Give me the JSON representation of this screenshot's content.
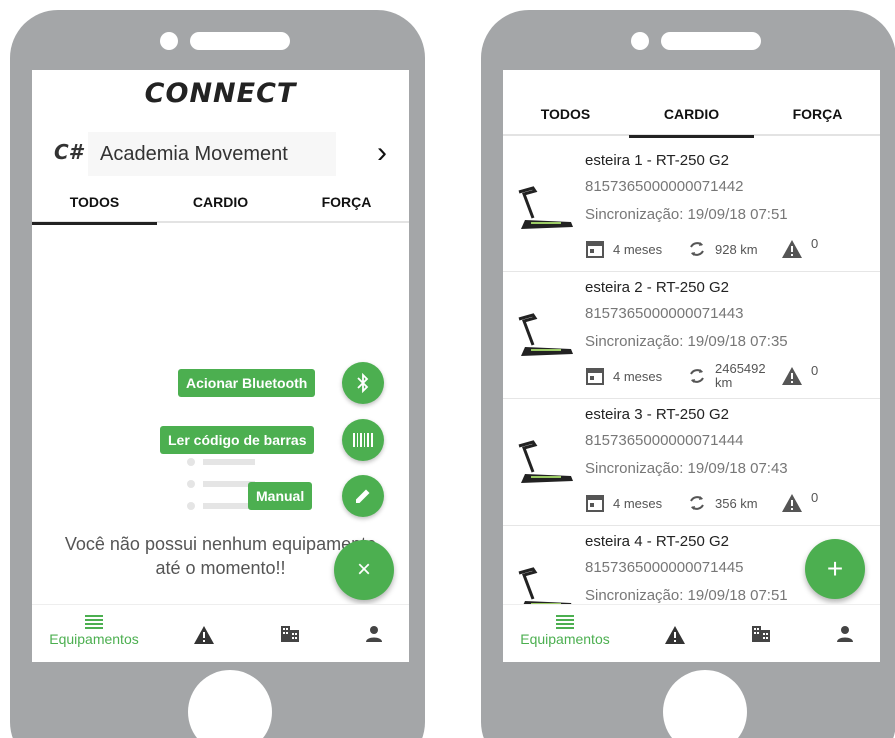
{
  "left_screen": {
    "logo": "CONNECT",
    "academy": {
      "mark": "C#",
      "name": "Academia Movement",
      "next": "›"
    },
    "tabs": [
      "TODOS",
      "CARDIO",
      "FORÇA"
    ],
    "active_tab": "TODOS",
    "actions": [
      {
        "label": "Acionar Bluetooth",
        "icon": "bluetooth-icon"
      },
      {
        "label": "Ler código de barras",
        "icon": "barcode-icon"
      },
      {
        "label": "Manual",
        "icon": "pencil-icon"
      }
    ],
    "close_fab": "×",
    "empty_message_line1": "Você não possui nenhum equipamento",
    "empty_message_line2": "até o momento!!",
    "nav": {
      "equipment_label": "Equipamentos"
    }
  },
  "right_screen": {
    "tabs": [
      "TODOS",
      "CARDIO",
      "FORÇA"
    ],
    "active_tab": "CARDIO",
    "items": [
      {
        "name": "esteira 1 - RT-250 G2",
        "serial": "8157365000000071442",
        "sync": "Sincronização: 19/09/18 07:51",
        "age": "4 meses",
        "distance": "928 km",
        "alerts": "0"
      },
      {
        "name": "esteira 2 - RT-250 G2",
        "serial": "8157365000000071443",
        "sync": "Sincronização: 19/09/18 07:35",
        "age": "4 meses",
        "distance": "2465492 km",
        "alerts": "0"
      },
      {
        "name": "esteira 3 - RT-250 G2",
        "serial": "8157365000000071444",
        "sync": "Sincronização: 19/09/18 07:43",
        "age": "4 meses",
        "distance": "356 km",
        "alerts": "0"
      },
      {
        "name": "esteira 4 - RT-250 G2",
        "serial": "8157365000000071445",
        "sync": "Sincronização: 19/09/18 07:51",
        "age": "",
        "distance": "",
        "alerts": ""
      }
    ],
    "add_fab": "+",
    "nav": {
      "equipment_label": "Equipamentos"
    }
  },
  "colors": {
    "accent": "#4caf50",
    "phone_body": "#a4a6a8"
  }
}
